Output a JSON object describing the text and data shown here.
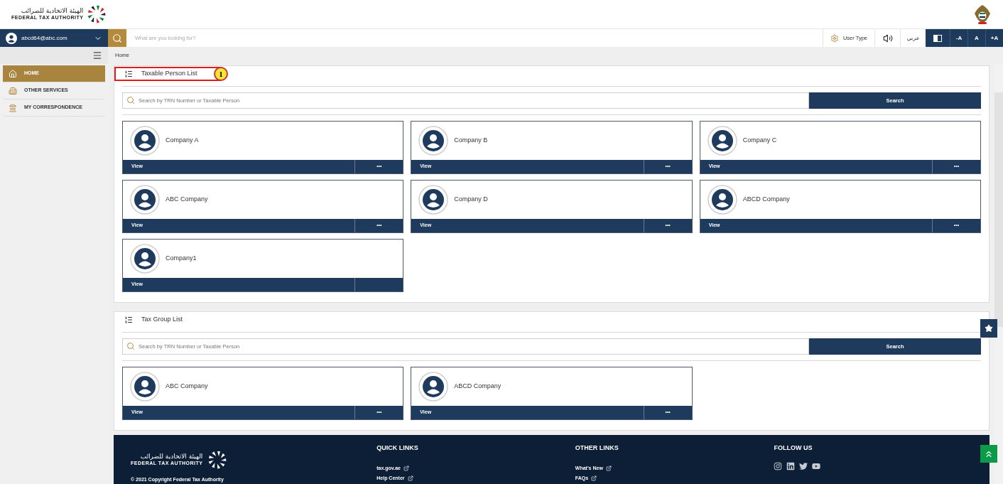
{
  "header": {
    "logo_arabic": "الهيئة الاتحادية للضرائب",
    "logo_english": "FEDERAL TAX AUTHORITY"
  },
  "toolbar": {
    "user": "abcd64@abc.com",
    "search_placeholder": "What are you looking for?",
    "user_type": "User Type",
    "language": "عربي",
    "font_buttons": [
      "-A",
      "A",
      "+A"
    ]
  },
  "breadcrumb": "Home",
  "sidebar": {
    "items": [
      {
        "label": "HOME",
        "kind": "home",
        "selected": true
      },
      {
        "label": "OTHER SERVICES",
        "kind": "services",
        "selected": false
      },
      {
        "label": "MY CORRESPONDENCE",
        "kind": "building",
        "selected": false
      }
    ]
  },
  "sections": [
    {
      "title": "Taxable Person List",
      "callout": "1",
      "search": {
        "placeholder": "Search by TRN Number or Taxable Person",
        "button": "Search"
      },
      "cards": [
        {
          "name": "Company A",
          "action": "View",
          "more": "•••"
        },
        {
          "name": "Company B",
          "action": "View",
          "more": "•••"
        },
        {
          "name": "Company C",
          "action": "View",
          "more": "•••"
        },
        {
          "name": "ABC Company",
          "action": "View",
          "more": "•••"
        },
        {
          "name": "Company D",
          "action": "View",
          "more": "•••"
        },
        {
          "name": "ABCD Company",
          "action": "View",
          "more": "•••"
        },
        {
          "name": "Company1",
          "action": "View"
        }
      ]
    },
    {
      "title": "Tax Group List",
      "search": {
        "placeholder": "Search by TRN Number or Taxable Person",
        "button": "Search"
      },
      "cards": [
        {
          "name": "ABC Company",
          "action": "View",
          "more": "•••"
        },
        {
          "name": "ABCD Company",
          "action": "View",
          "more": "•••"
        }
      ]
    }
  ],
  "footer": {
    "logo_arabic": "الهيئة الاتحادية للضرائب",
    "logo_english": "FEDERAL TAX AUTHORITY",
    "copyright": "© 2021 Copyright Federal Tax Authority",
    "columns": [
      {
        "title": "QUICK LINKS",
        "kind": "links",
        "links": [
          "tax.gov.ae",
          "Help Center"
        ]
      },
      {
        "title": "OTHER LINKS",
        "kind": "links",
        "links": [
          "What's New",
          "FAQs"
        ]
      },
      {
        "title": "FOLLOW US",
        "kind": "social"
      }
    ]
  }
}
